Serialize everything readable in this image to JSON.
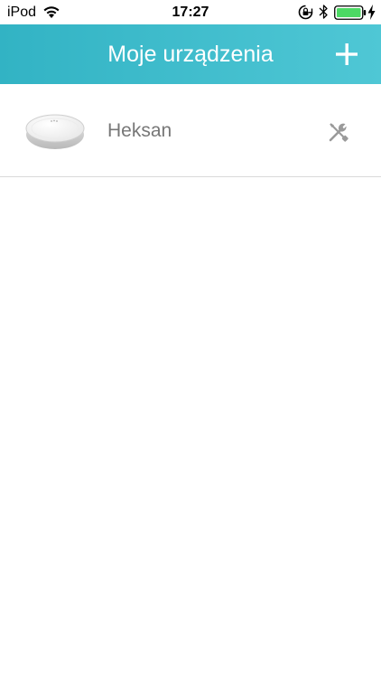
{
  "status_bar": {
    "carrier": "iPod",
    "time": "17:27",
    "battery_color": "#4cd964"
  },
  "nav": {
    "title": "Moje urządzenia",
    "add_icon": "plus-icon",
    "gradient_start": "#32b3c4",
    "gradient_end": "#4fc7d5"
  },
  "devices": [
    {
      "name": "Heksan",
      "image": "robot-vacuum-image",
      "action_icon": "tools-icon"
    }
  ]
}
